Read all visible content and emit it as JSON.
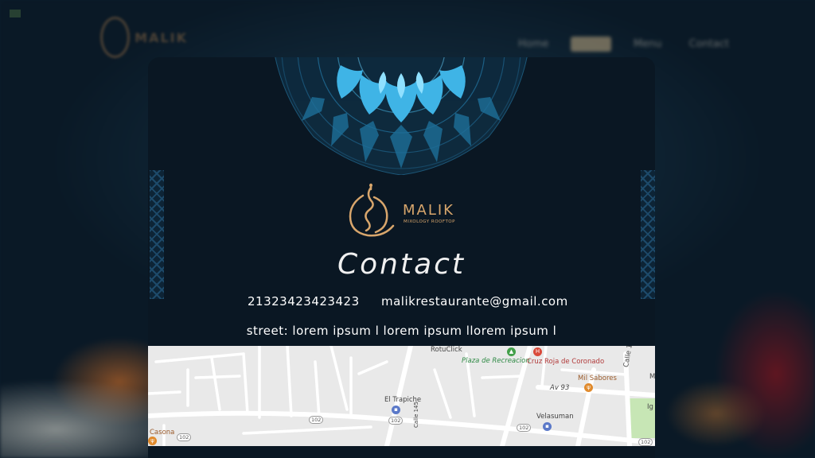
{
  "nav": {
    "logo_text": "MALIK",
    "items": [
      {
        "label": "Home",
        "active": false
      },
      {
        "label": "About",
        "active": true
      },
      {
        "label": "Menu",
        "active": false
      },
      {
        "label": "Contact",
        "active": false
      }
    ]
  },
  "modal": {
    "brand": "MALIK",
    "brand_sub": "MIXOLOGY ROOFTOP",
    "title": "Contact",
    "phone": "21323423423423",
    "email": "malikrestaurante@gmail.com",
    "street": "street: lorem ipsum l lorem ipsum llorem ipsum l"
  },
  "map": {
    "labels": {
      "rotuclick": "RotuClick",
      "plaza": "Plaza de Recreacion",
      "cruz_roja": "Cruz Roja de Coronado",
      "mil_sabores": "Mil Sabores",
      "av93": "Av 93",
      "calle153": "Calle 153",
      "el_trapiche": "El Trapiche",
      "velasuman": "Velasuman",
      "casona": "Casona",
      "calle145": "Calle 145",
      "ig": "Ig",
      "m": "M"
    },
    "road_numbers": [
      "102",
      "102",
      "102",
      "102",
      "102"
    ]
  },
  "colors": {
    "accent": "#d8a66c",
    "modal_bg": "#0a1723",
    "mandala": "#3fa9d8"
  }
}
